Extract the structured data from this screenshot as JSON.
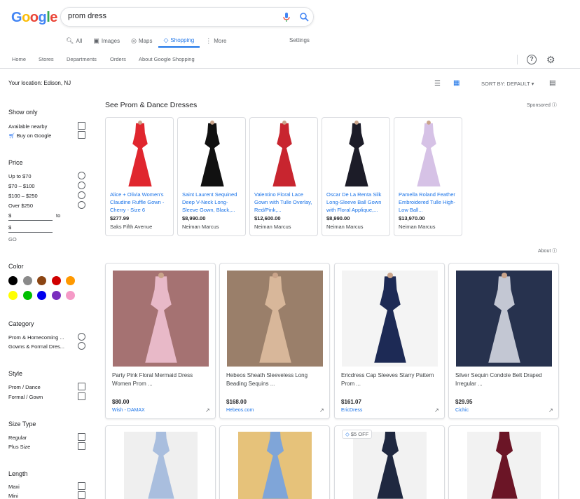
{
  "logo": {
    "text": "Google"
  },
  "search": {
    "query": "prom dress"
  },
  "tabs": [
    {
      "label": "All",
      "icon": "search-icon"
    },
    {
      "label": "Images",
      "icon": "image-icon"
    },
    {
      "label": "Maps",
      "icon": "map-pin-icon"
    },
    {
      "label": "Shopping",
      "icon": "tag-icon",
      "active": true
    },
    {
      "label": "More",
      "icon": "more-vert-icon"
    }
  ],
  "settings_label": "Settings",
  "subnav": [
    "Home",
    "Stores",
    "Departments",
    "Orders",
    "About Google Shopping"
  ],
  "location": "Your location: Edison, NJ",
  "sort_label": "SORT BY: DEFAULT",
  "sidebar": {
    "show_only": {
      "title": "Show only",
      "items": [
        "Available nearby",
        "Buy on Google"
      ]
    },
    "price": {
      "title": "Price",
      "items": [
        "Up to $70",
        "$70 – $100",
        "$100 – $250",
        "Over $250"
      ],
      "min_placeholder": "$",
      "max_placeholder": "$",
      "to": "to",
      "go": "GO"
    },
    "color": {
      "title": "Color",
      "swatches": [
        "#000000",
        "#8a8a8a",
        "#8b4513",
        "#d00000",
        "#ff9900",
        "#ffff00",
        "#00c000",
        "#0000ee",
        "#7b2fbe",
        "#f59ac7"
      ]
    },
    "category": {
      "title": "Category",
      "items": [
        "Prom & Homecoming ...",
        "Gowns & Formal Dres..."
      ]
    },
    "style": {
      "title": "Style",
      "items": [
        "Prom / Dance",
        "Formal / Gown"
      ]
    },
    "size_type": {
      "title": "Size Type",
      "items": [
        "Regular",
        "Plus Size"
      ]
    },
    "length": {
      "title": "Length",
      "items": [
        "Maxi",
        "Mini"
      ]
    }
  },
  "sponsored_section": {
    "title": "See Prom & Dance Dresses",
    "sponsored_label": "Sponsored",
    "items": [
      {
        "title": "Alice + Olivia Women's Claudine Ruffle Gown - Cherry - Size 6",
        "price": "$277.99",
        "store": "Saks Fifth Avenue",
        "color": "#e0262e"
      },
      {
        "title": "Saint Laurent Sequined Deep V-Neck Long-Sleeve Gown, Black,...",
        "price": "$8,990.00",
        "store": "Neiman Marcus",
        "color": "#111111"
      },
      {
        "title": "Valentino Floral Lace Gown with Tulle Overlay, Red/Pink,...",
        "price": "$12,600.00",
        "store": "Neiman Marcus",
        "color": "#c8252f"
      },
      {
        "title": "Oscar De La Renta Silk Long-Sleeve Ball Gown with Floral Applique,...",
        "price": "$8,990.00",
        "store": "Neiman Marcus",
        "color": "#1c1c28"
      },
      {
        "title": "Pamella Roland Feather Embroidered Tulle High-Low Ball...",
        "price": "$13,970.00",
        "store": "Neiman Marcus",
        "color": "#d6c2e6"
      }
    ]
  },
  "about_label": "About",
  "results": [
    {
      "title": "Party Pink Floral Mermaid Dress Women Prom ...",
      "price": "$80.00",
      "store": "Wish - DAMAX",
      "bg": "#a57272",
      "dress": "#e8b9c8"
    },
    {
      "title": "Hebeos Sheath Sleeveless Long Beading Sequins ...",
      "price": "$168.00",
      "store": "Hebeos.com",
      "bg": "#9a7f6a",
      "dress": "#d8b79a"
    },
    {
      "title": "Ericdress Cap Sleeves Starry Pattern Prom ...",
      "price": "$161.07",
      "store": "EricDress",
      "bg": "#f4f4f4",
      "dress": "#1d2a55"
    },
    {
      "title": "Silver Sequin Condole Belt Draped Irregular ...",
      "price": "$29.95",
      "store": "Cichic",
      "bg": "#27324e",
      "dress": "#c3c7d3"
    }
  ],
  "row2": [
    {
      "bg": "#efefef",
      "dress": "#a9bede"
    },
    {
      "bg": "#e6c27a",
      "dress": "#7fa5d8"
    },
    {
      "bg": "#f2f2f2",
      "dress": "#1f2840",
      "badge": "$5 OFF"
    },
    {
      "bg": "#f2f2f2",
      "dress": "#6b1526"
    }
  ]
}
